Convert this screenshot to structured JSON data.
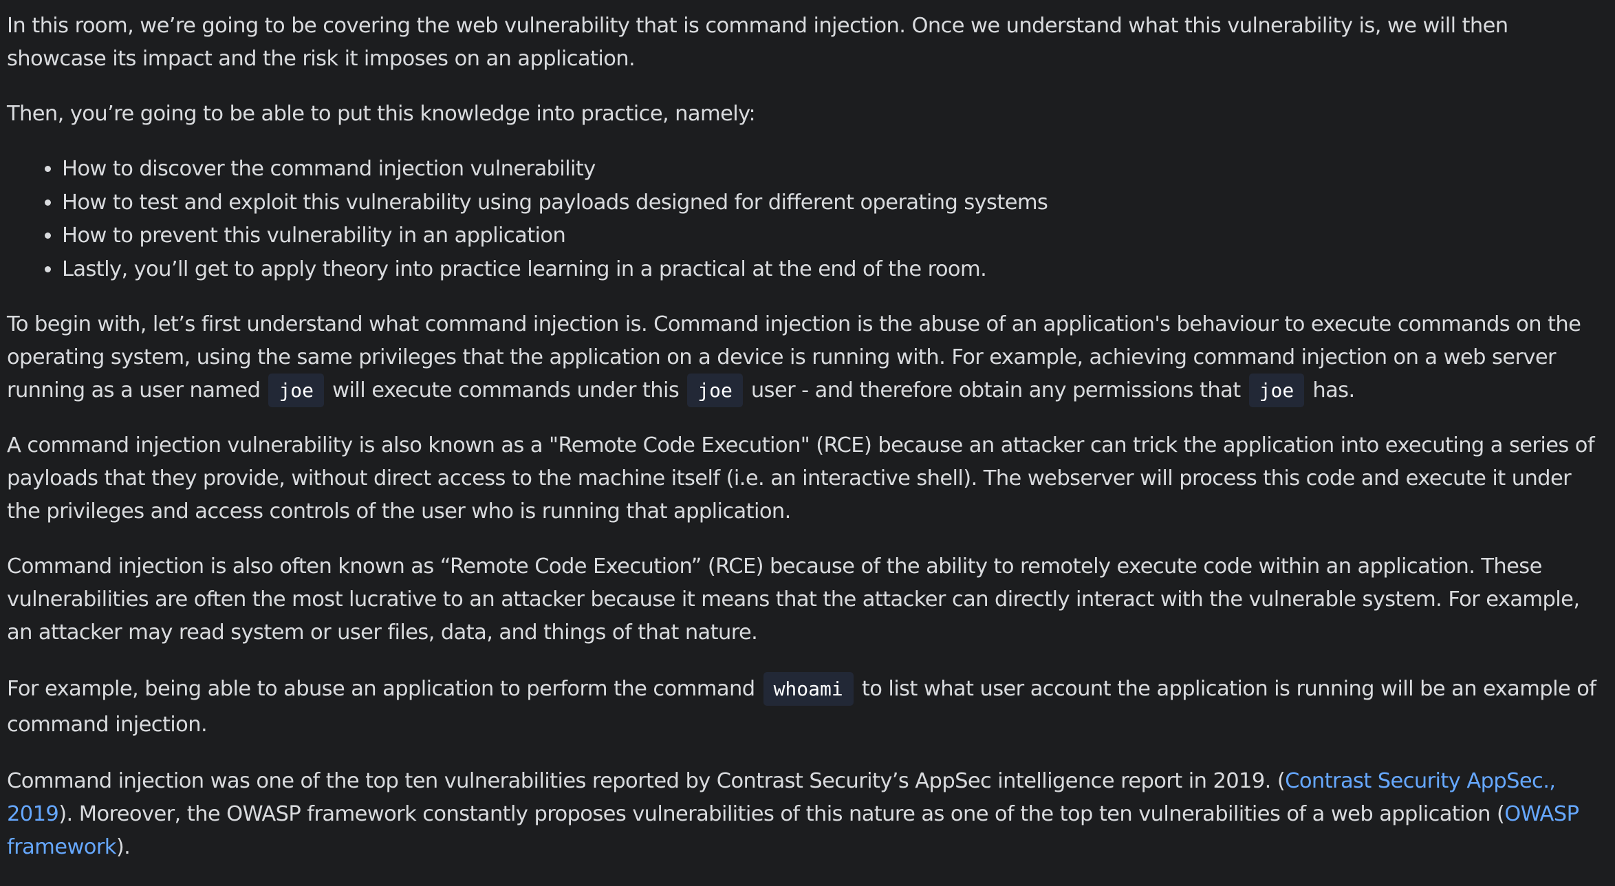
{
  "intro": {
    "p1": "In this room, we’re going to be covering the web vulnerability that is command injection. Once we understand what this vulnerability is, we will then showcase its impact and the risk it imposes on an application.",
    "p2": "Then, you’re going to be able to put this knowledge into practice, namely:",
    "bullets": [
      "How to discover the command injection vulnerability",
      "How to test and exploit this vulnerability using payloads designed for different operating systems",
      "How to prevent this vulnerability in an application",
      "Lastly, you’ll get to apply theory into practice learning in a practical at the end of the room."
    ]
  },
  "definition": {
    "text1": "To begin with, let’s first understand what command injection is. Command injection is the abuse of an application's behaviour to execute commands on the operating system, using the same privileges that the application on a device is running with. For example, achieving command injection on a web server running as a user named",
    "code1": "joe",
    "text2": "will execute commands under this",
    "code2": "joe",
    "text3": "user - and therefore obtain any permissions that",
    "code3": "joe",
    "text4": "has."
  },
  "rce": {
    "p1": "A command injection vulnerability is also known as a \"Remote Code Execution\" (RCE) because an attacker can trick the application into executing a series of payloads that they provide, without direct access to the machine itself (i.e. an interactive shell). The webserver will process this code and execute it under the privileges and access controls of the user who is running that application.",
    "p2": "Command injection is also often known as “Remote Code Execution” (RCE) because of the ability to remotely execute code within an application. These vulnerabilities are often the most lucrative to an attacker because it means that the attacker can directly interact with the vulnerable system. For example, an attacker may read system or user files, data, and things of that nature."
  },
  "example": {
    "text1": "For example, being able to abuse an application to perform the command",
    "code": "whoami",
    "text2": "to list what user account the application is running will be an example of command injection."
  },
  "references": {
    "text1": "Command injection was one of the top ten vulnerabilities reported by Contrast Security’s AppSec intelligence report in 2019. (",
    "link1": "Contrast Security AppSec., 2019",
    "text2": "). Moreover, the OWASP framework constantly proposes vulnerabilities of this nature as one of the top ten vulnerabilities of a web application (",
    "link2": "OWASP framework",
    "text3": ")."
  },
  "colors": {
    "background": "#1c1d1f",
    "text": "#d9dbde",
    "link": "#66a8ff",
    "code_background": "#222836"
  }
}
